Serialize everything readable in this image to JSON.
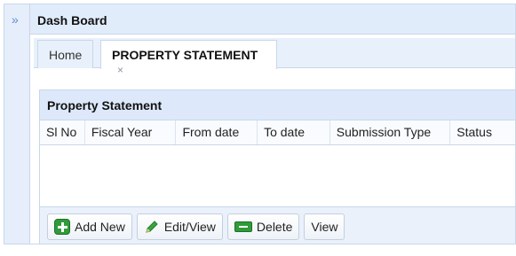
{
  "rail": {
    "expand_icon": "»"
  },
  "board": {
    "title": "Dash Board"
  },
  "tabs": [
    {
      "label": "Home"
    },
    {
      "label": "PROPERTY STATEMENT",
      "close": "×"
    }
  ],
  "panel": {
    "title": "Property Statement",
    "columns": [
      "Sl No",
      "Fiscal Year",
      "From date",
      "To date",
      "Submission Type",
      "Status"
    ]
  },
  "toolbar": {
    "add_label": "Add New",
    "edit_label": "Edit/View",
    "delete_label": "Delete",
    "view_label": "View"
  },
  "colors": {
    "accent": "#5b8fd1",
    "header_bg": "#e1ecfa",
    "border": "#c9d7ea",
    "icon_green": "#2f9b3a"
  },
  "icons": [
    "double-chevron-right-icon",
    "close-icon",
    "add-icon",
    "pencil-icon",
    "delete-icon"
  ]
}
